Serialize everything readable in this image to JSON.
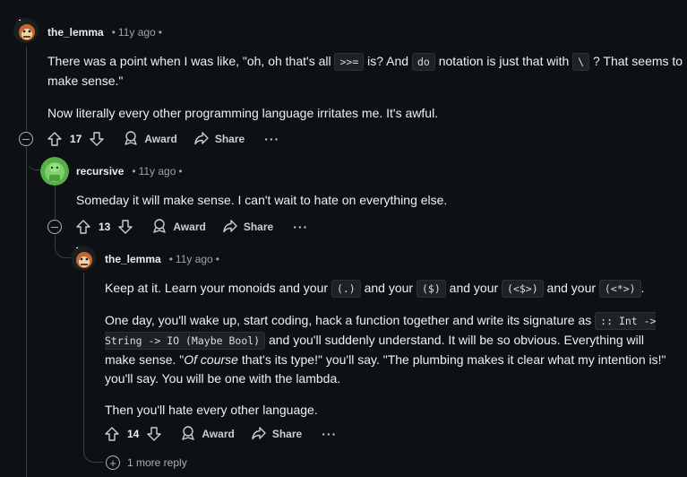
{
  "comments": [
    {
      "author": "the_lemma",
      "age": "11y ago",
      "avatar": "lemma-avatar",
      "p1_a": "There was a point when I was like, \"oh, oh that's all ",
      "p1_code1": ">>=",
      "p1_b": " is? And ",
      "p1_code2": "do",
      "p1_c": " notation is just that with ",
      "p1_code3": "\\",
      "p1_d": " ? That seems to make sense.\"",
      "p2": "Now literally every other programming language irritates me. It's awful.",
      "votes": "17",
      "award_label": "Award",
      "share_label": "Share",
      "more_label": "···"
    },
    {
      "author": "recursive",
      "age": "11y ago",
      "avatar": "recursive-avatar",
      "p1": "Someday it will make sense. I can't wait to hate on everything else.",
      "votes": "13",
      "award_label": "Award",
      "share_label": "Share",
      "more_label": "···"
    },
    {
      "author": "the_lemma",
      "age": "11y ago",
      "avatar": "lemma-avatar",
      "p1_a": "Keep at it. Learn your monoids and your ",
      "p1_code1": "(.)",
      "p1_b": " and your ",
      "p1_code2": "($)",
      "p1_c": " and your ",
      "p1_code3": "(<$>)",
      "p1_d": " and your ",
      "p1_code4": "(<*>)",
      "p1_e": ".",
      "p2_a": "One day, you'll wake up, start coding, hack a function together and write its signature as ",
      "p2_code": ":: Int -> String -> IO (Maybe Bool)",
      "p2_b": " and you'll suddenly understand. It will be so obvious. Everything will make sense. \"",
      "p2_em": "Of course",
      "p2_c": " that's its type!\" you'll say. \"The plumbing makes it clear what my intention is!\" you'll say. You will be one with the lambda.",
      "p3": "Then you'll hate every other language.",
      "votes": "14",
      "award_label": "Award",
      "share_label": "Share",
      "more_label": "···"
    }
  ],
  "more_replies": "1 more reply",
  "separator": "•"
}
